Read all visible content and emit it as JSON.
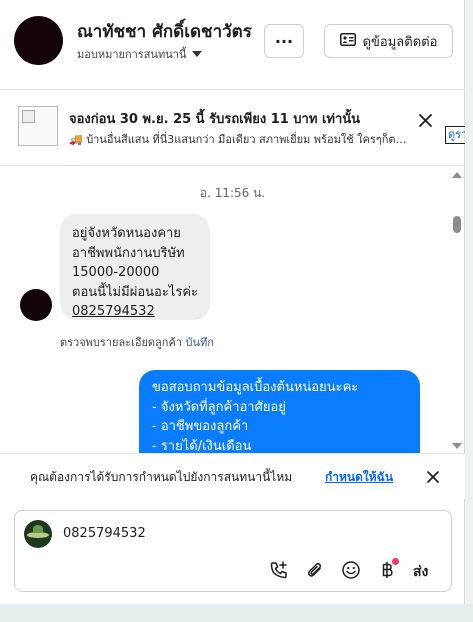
{
  "header": {
    "name": "ณาทัชชา ศักดิ์เดชาวัตร",
    "assign_label": "มอบหมายการสนทนานี้",
    "more_label": "···",
    "contact_button": "ดูข้อมูลติดต่อ"
  },
  "ad": {
    "title": "จองก่อน 30 พ.ย. 25 นี้ รับรถเพียง 11 บาท เท่านั้น",
    "subtitle": "🚚 บ้านอื่นสีแสน ที่นี่3แสนกว่า มือเดียว สภาพเยี่ยม พร้อมใช้ ใครๆก็ตามหา...",
    "link_label": "ดูรายละเอียด"
  },
  "messages": {
    "timestamp": "อ. 11:56 น.",
    "incoming": {
      "line1": "อยู่จังหวัดหนองคาย",
      "line2": "อาชีพพนักงานบริษัท",
      "line3": "15000-20000",
      "line4": "ตอนนี้ไม่มีผ่อนอะไรค่ะ",
      "phone": "0825794532"
    },
    "detail_text": "ตรวจพบรายละเอียดลูกค้า",
    "detail_save": "บันทึก",
    "outgoing": {
      "line1": "ขอสอบถามข้อมูลเบื้องต้นหน่อยนะคะ",
      "line2": "- จังหวัดที่ลูกค้าอาศัยอยู่",
      "line3": "- อาชีพของลูกค้า",
      "line4": "- รายได้/เงินเดือน"
    }
  },
  "reminder": {
    "text": "คุณต้องการได้รับการกำหนดไปยังการสนทนานี้ไหม",
    "link": "กำหนดให้ฉัน"
  },
  "composer": {
    "value": "0825794532",
    "send_label": "ส่ง"
  },
  "colors": {
    "accent": "#0866ff",
    "outgoing_bubble": "#0a7cff",
    "incoming_bubble": "#eeeeee",
    "notification_dot": "#f23a5e"
  }
}
